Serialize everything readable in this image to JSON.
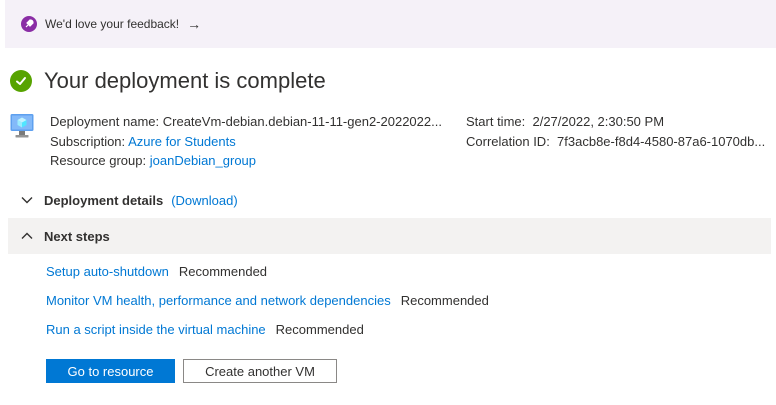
{
  "feedback": {
    "text": "We'd love your feedback!",
    "arrow": "→"
  },
  "header": {
    "title": "Your deployment is complete"
  },
  "deployment": {
    "name_label": "Deployment name:",
    "name_value": "CreateVm-debian.debian-11-11-gen2-2022022...",
    "subscription_label": "Subscription:",
    "subscription_value": "Azure for Students",
    "resource_group_label": "Resource group:",
    "resource_group_value": "joanDebian_group",
    "start_time_label": "Start time:",
    "start_time_value": "2/27/2022, 2:30:50 PM",
    "correlation_label": "Correlation ID:",
    "correlation_value": "7f3acb8e-f8d4-4580-87a6-1070db..."
  },
  "sections": {
    "details_title": "Deployment details",
    "details_link": "(Download)",
    "next_title": "Next steps"
  },
  "steps": [
    {
      "link": "Setup auto-shutdown",
      "tag": "Recommended"
    },
    {
      "link": "Monitor VM health, performance and network dependencies",
      "tag": "Recommended"
    },
    {
      "link": "Run a script inside the virtual machine",
      "tag": "Recommended"
    }
  ],
  "buttons": {
    "primary": "Go to resource",
    "secondary": "Create another VM"
  },
  "colors": {
    "accent": "#0078d4",
    "success": "#57a300",
    "feedback_icon": "#8a2da5"
  },
  "icons": [
    "rocket-icon",
    "arrow-right-icon",
    "checkmark-circle-icon",
    "virtual-machine-icon",
    "chevron-down-icon",
    "chevron-up-icon"
  ]
}
